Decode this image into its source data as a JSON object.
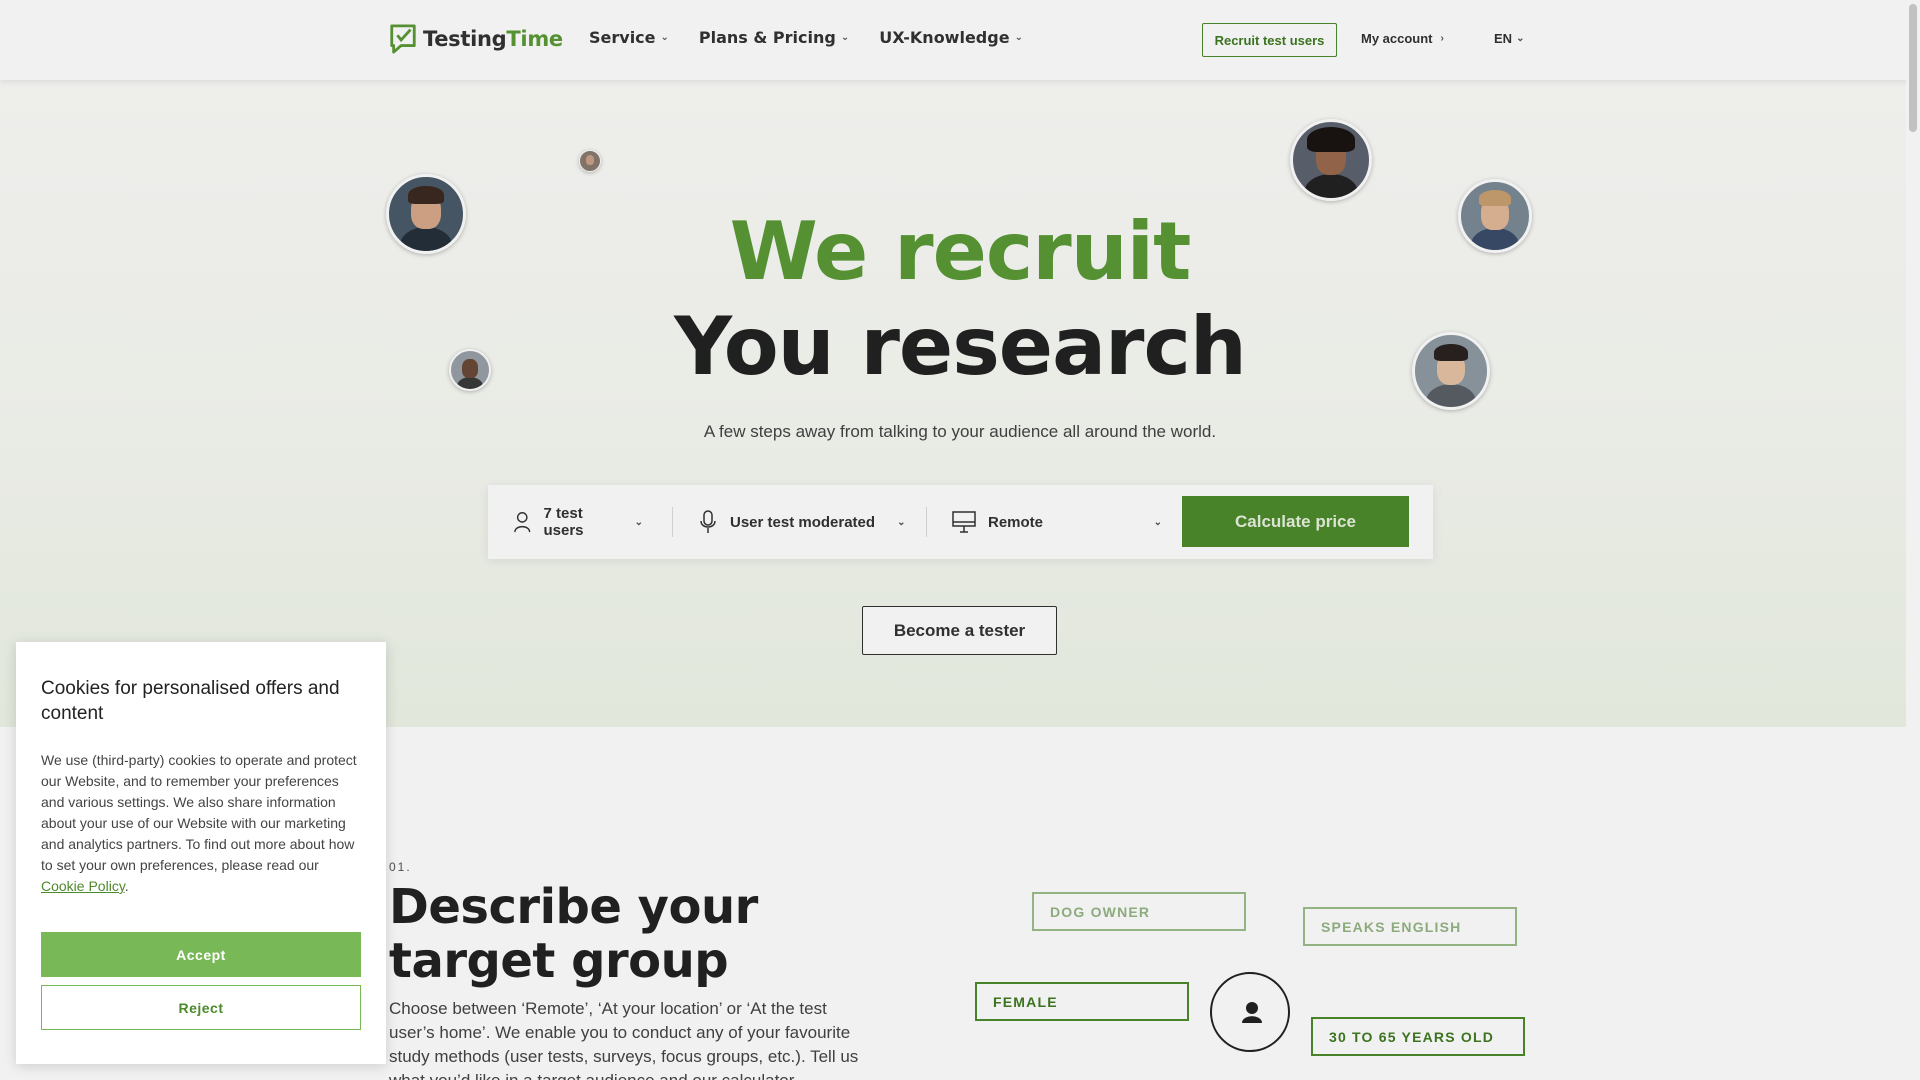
{
  "header": {
    "logo": {
      "part1": "Testing",
      "part2": "Time"
    },
    "nav": [
      {
        "label": "Service"
      },
      {
        "label": "Plans & Pricing"
      },
      {
        "label": "UX-Knowledge"
      }
    ],
    "recruit_label": "Recruit test users",
    "account_label": "My account",
    "lang_label": "EN"
  },
  "hero": {
    "title_line1": "We recruit",
    "title_line2": "You research",
    "subtitle": "A few steps away from talking to your audience all around the world.",
    "calculator": {
      "users": "7 test users",
      "method": "User test moderated",
      "location": "Remote",
      "button": "Calculate price"
    },
    "tester_button": "Become a tester"
  },
  "section": {
    "number": "01.",
    "title": "Describe your target group",
    "text": "Choose between ‘Remote’, ‘At your location’ or ‘At the test user’s home’. We enable you to conduct any of your favourite study methods (user tests, surveys, focus groups, etc.). Tell us what you’d like in a target audience and our calculator",
    "tags": {
      "dog_owner": "DOG OWNER",
      "speaks_english": "SPEAKS ENGLISH",
      "female": "FEMALE",
      "age": "30 TO 65 YEARS OLD"
    }
  },
  "cookie": {
    "title": "Cookies for personalised offers and content",
    "body": "We use (third-party) cookies to operate and protect our Website, and to remember your preferences and various settings. We also share information about your use of our Website with our marketing and analytics partners. To find out more about how to set your own preferences, please read our ",
    "link": "Cookie Policy",
    "after": ".",
    "accept": "Accept",
    "reject": "Reject"
  },
  "colors": {
    "brand_green": "#5a9a36",
    "button_green": "#4d8a2c",
    "cookie_green": "#79b857"
  }
}
